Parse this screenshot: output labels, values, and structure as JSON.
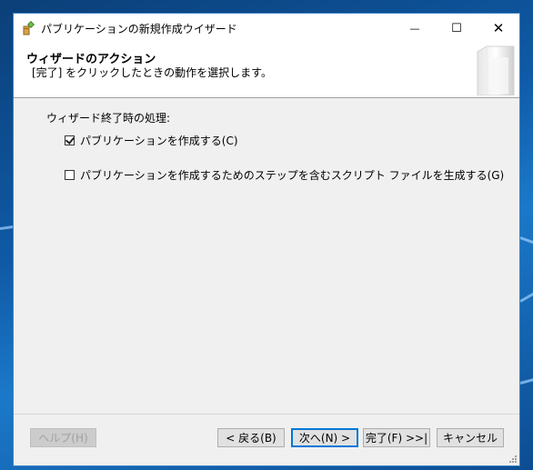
{
  "window": {
    "title": "パブリケーションの新規作成ウイザード",
    "controls": {
      "minimize": "—",
      "maximize": "☐",
      "close": "✕"
    }
  },
  "header": {
    "title": "ウィザードのアクション",
    "subtitle": "[完了] をクリックしたときの動作を選択します。"
  },
  "content": {
    "group_label": "ウィザード終了時の処理:",
    "options": [
      {
        "label": "パブリケーションを作成する(C)",
        "checked": true
      },
      {
        "label": "パブリケーションを作成するためのステップを含むスクリプト ファイルを生成する(G)",
        "checked": false
      }
    ]
  },
  "buttons": {
    "help": "ヘルプ(H)",
    "back": "< 戻る(B)",
    "next": "次へ(N) >",
    "finish": "完了(F) >>|",
    "cancel": "キャンセル"
  },
  "icons": {
    "app": "wizard-gear-icon",
    "header_art": "glass-panel-icon"
  },
  "colors": {
    "accent": "#0078d7",
    "window_border": "#3c7fc4"
  }
}
